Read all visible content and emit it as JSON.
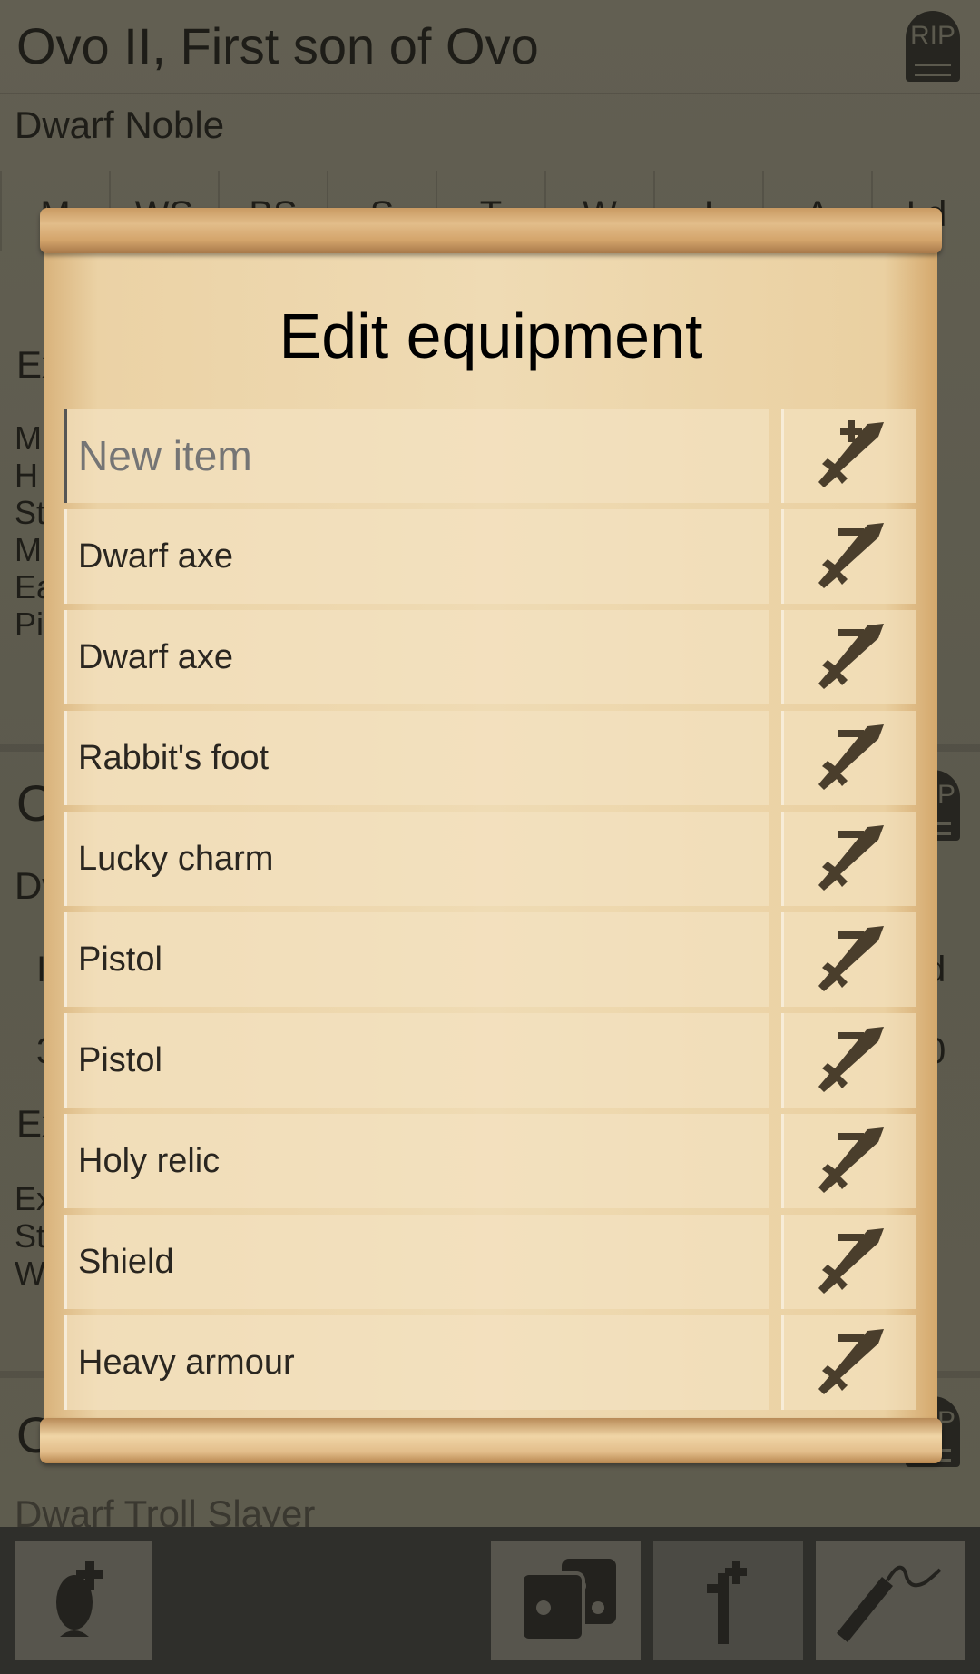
{
  "background": {
    "character1": {
      "name": "Ovo II, First son of Ovo",
      "career": "Dwarf Noble",
      "stat_headers": [
        "M",
        "WS",
        "BS",
        "S",
        "T",
        "W",
        "I",
        "A",
        "Ld"
      ],
      "section_fragment": "Ex",
      "list_fragments": [
        "M",
        "H",
        "St",
        "M",
        "Ea",
        "Pi"
      ]
    },
    "character2": {
      "name_fragment": "O",
      "career_fragment": "Dw",
      "stat_fragment_left": "I",
      "stat_fragment_right": "d",
      "value_fragment_left": "3",
      "value_fragment_right": "0",
      "section_fragment": "Ex",
      "list_fragments": [
        "Ex",
        "St",
        "W"
      ]
    },
    "character3": {
      "name_fragment": "O",
      "career": "Dwarf Troll Slayer"
    },
    "rip_label": "RIP"
  },
  "dialog": {
    "title": "Edit equipment",
    "new_item": {
      "value": "",
      "placeholder": "New item",
      "button_icon": "sword-plus-icon"
    },
    "items": [
      {
        "label": "Dwarf axe"
      },
      {
        "label": "Dwarf axe"
      },
      {
        "label": "Rabbit's foot"
      },
      {
        "label": "Lucky charm"
      },
      {
        "label": "Pistol"
      },
      {
        "label": "Pistol"
      },
      {
        "label": "Holy relic"
      },
      {
        "label": "Shield"
      },
      {
        "label": "Heavy armour"
      }
    ],
    "remove_icon": "sword-minus-icon"
  },
  "bottom_bar": {
    "buttons": [
      {
        "icon": "add-character-egg-icon"
      },
      {
        "icon": "dice-icon"
      },
      {
        "icon": "add-grave-icon"
      },
      {
        "icon": "dynamite-icon"
      }
    ]
  },
  "colors": {
    "parchment": "#efdbb4",
    "icon": "#4a3e2c",
    "bar": "#2f2f2b"
  }
}
